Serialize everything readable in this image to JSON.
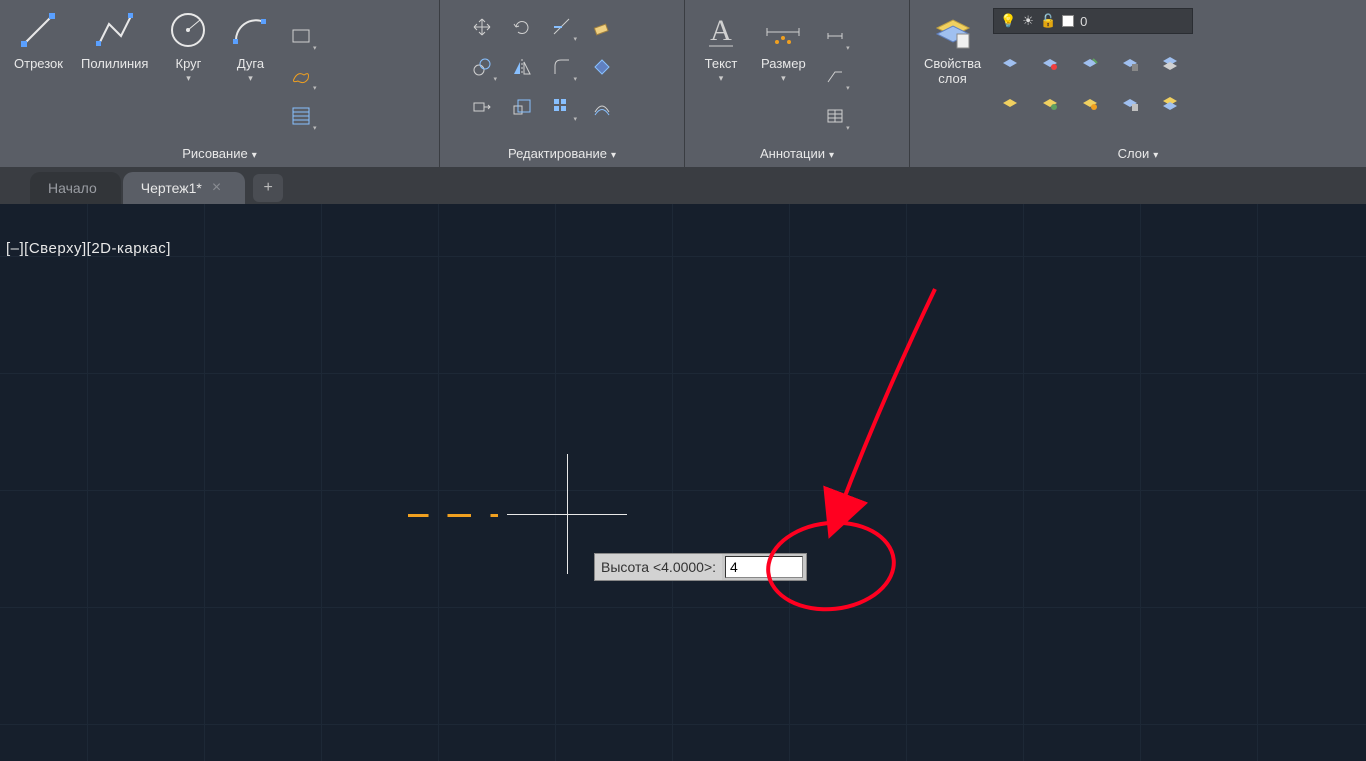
{
  "ribbon": {
    "draw": {
      "title": "Рисование",
      "line": "Отрезок",
      "polyline": "Полилиния",
      "circle": "Круг",
      "arc": "Дуга"
    },
    "edit": {
      "title": "Редактирование"
    },
    "annotate": {
      "title": "Аннотации",
      "text": "Текст",
      "dimension": "Размер"
    },
    "layers": {
      "title": "Слои",
      "properties_l1": "Свойства",
      "properties_l2": "слоя",
      "current": "0"
    }
  },
  "tabs": {
    "home": "Начало",
    "drawing": "Чертеж1*"
  },
  "viewport": {
    "label": "[–][Сверху][2D-каркас]"
  },
  "prompt": {
    "label": "Высота <4.0000>:",
    "value": "4"
  }
}
